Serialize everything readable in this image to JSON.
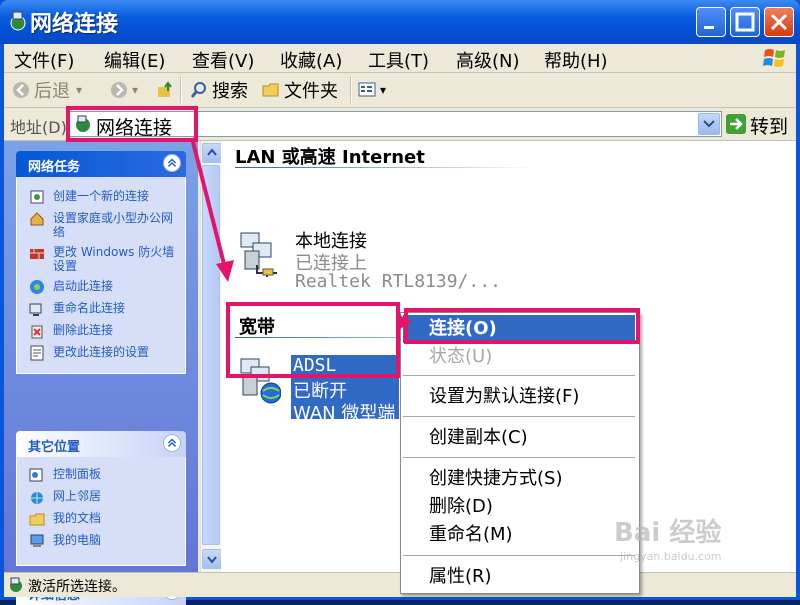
{
  "window": {
    "title": "网络连接"
  },
  "menubar": [
    "文件(F)",
    "编辑(E)",
    "查看(V)",
    "收藏(A)",
    "工具(T)",
    "高级(N)",
    "帮助(H)"
  ],
  "toolbar": {
    "back": "后退",
    "search": "搜索",
    "folders": "文件夹"
  },
  "address": {
    "label": "地址(D)",
    "value": "网络连接",
    "go": "转到"
  },
  "taskpane": {
    "network_tasks": {
      "title": "网络任务",
      "items": [
        "创建一个新的连接",
        "设置家庭或小型办公网络",
        "更改 Windows 防火墙设置",
        "启动此连接",
        "重命名此连接",
        "删除此连接",
        "更改此连接的设置"
      ]
    },
    "other_places": {
      "title": "其它位置",
      "items": [
        "控制面板",
        "网上邻居",
        "我的文档",
        "我的电脑"
      ]
    },
    "details": {
      "title": "详细信息"
    }
  },
  "content": {
    "lan_section": "LAN 或高速 Internet",
    "local": {
      "name": "本地连接",
      "status": "已连接上",
      "device": "Realtek RTL8139/..."
    },
    "broadband_section": "宽带",
    "adsl": {
      "name": "ADSL",
      "status": "已断开",
      "device": "WAN 微型端"
    }
  },
  "context_menu": {
    "items": [
      {
        "label": "连接(O)",
        "state": "active"
      },
      {
        "label": "状态(U)",
        "state": "disabled"
      },
      {
        "label": "设置为默认连接(F)",
        "state": "normal"
      },
      {
        "label": "创建副本(C)",
        "state": "normal"
      },
      {
        "label": "创建快捷方式(S)",
        "state": "normal"
      },
      {
        "label": "删除(D)",
        "state": "normal"
      },
      {
        "label": "重命名(M)",
        "state": "normal"
      },
      {
        "label": "属性(R)",
        "state": "normal"
      }
    ]
  },
  "statusbar": {
    "text": "激活所选连接。"
  },
  "watermark": {
    "text": "Bai 经验",
    "sub": "jingyan.baidu.com"
  },
  "colors": {
    "highlight": "#e2156b",
    "selection": "#316ac5",
    "xp_blue": "#0a56d8"
  }
}
